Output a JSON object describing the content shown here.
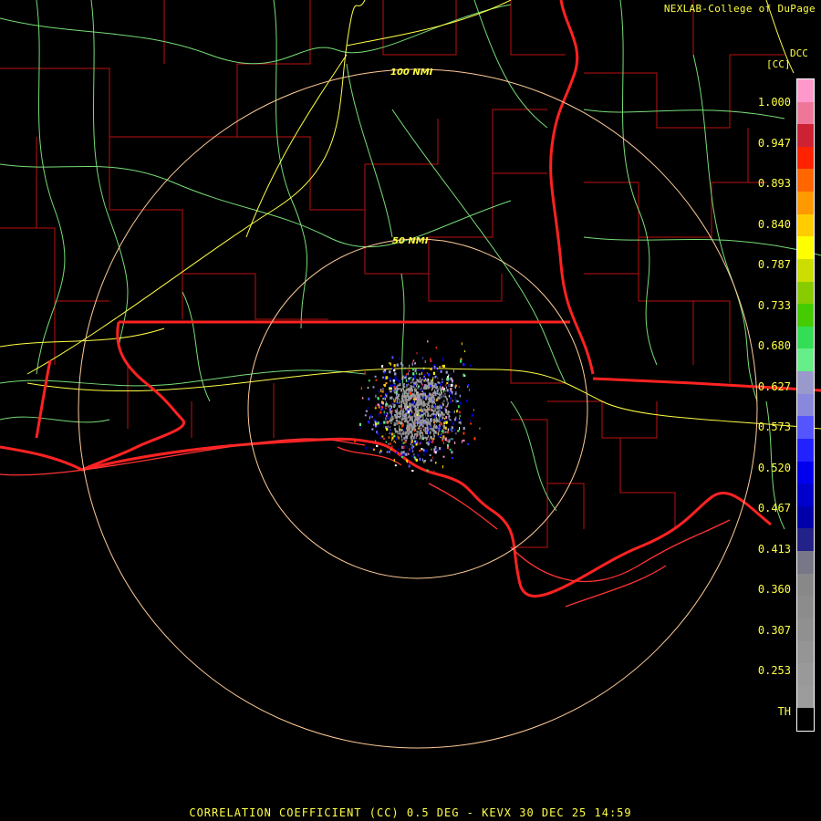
{
  "header": {
    "credit": "NEXLAB-College of DuPage",
    "product_code": "DCC",
    "unit": "[CC]"
  },
  "rings": [
    {
      "label": "100 NMI"
    },
    {
      "label": "50 NMI"
    }
  ],
  "legend": {
    "ticks": [
      "1.000",
      "0.947",
      "0.893",
      "0.840",
      "0.787",
      "0.733",
      "0.680",
      "0.627",
      "0.573",
      "0.520",
      "0.467",
      "0.413",
      "0.360",
      "0.307",
      "0.253",
      "TH"
    ],
    "segments": [
      {
        "color": "#ff99cc"
      },
      {
        "color": "#ee7799"
      },
      {
        "color": "#cc2233"
      },
      {
        "color": "#ff2200"
      },
      {
        "color": "#ff6600"
      },
      {
        "color": "#ff9900"
      },
      {
        "color": "#ffcc00"
      },
      {
        "color": "#ffff00"
      },
      {
        "color": "#ccdd00"
      },
      {
        "color": "#88cc00"
      },
      {
        "color": "#44cc00"
      },
      {
        "color": "#33dd55"
      },
      {
        "color": "#66ee88"
      },
      {
        "color": "#9999cc"
      },
      {
        "color": "#8888dd"
      },
      {
        "color": "#5555ff"
      },
      {
        "color": "#2222ff"
      },
      {
        "color": "#0000ee"
      },
      {
        "color": "#0000cc"
      },
      {
        "color": "#0000aa"
      },
      {
        "color": "#222288"
      },
      {
        "color": "#777788"
      },
      {
        "color": "#888888"
      },
      {
        "color": "#8c8c8c"
      },
      {
        "color": "#909090"
      },
      {
        "color": "#959595"
      },
      {
        "color": "#999999"
      },
      {
        "color": "#9c9c9c"
      },
      {
        "color": "#000000"
      }
    ]
  },
  "caption": "CORRELATION COEFFICIENT (CC) 0.5 DEG - KEVX 30 DEC 25 14:59",
  "colors": {
    "state_line": "#ff2222",
    "county_line": "#cc1111",
    "highway": "#ffff44",
    "road": "#88ee88",
    "ring": "#ffcc99"
  }
}
